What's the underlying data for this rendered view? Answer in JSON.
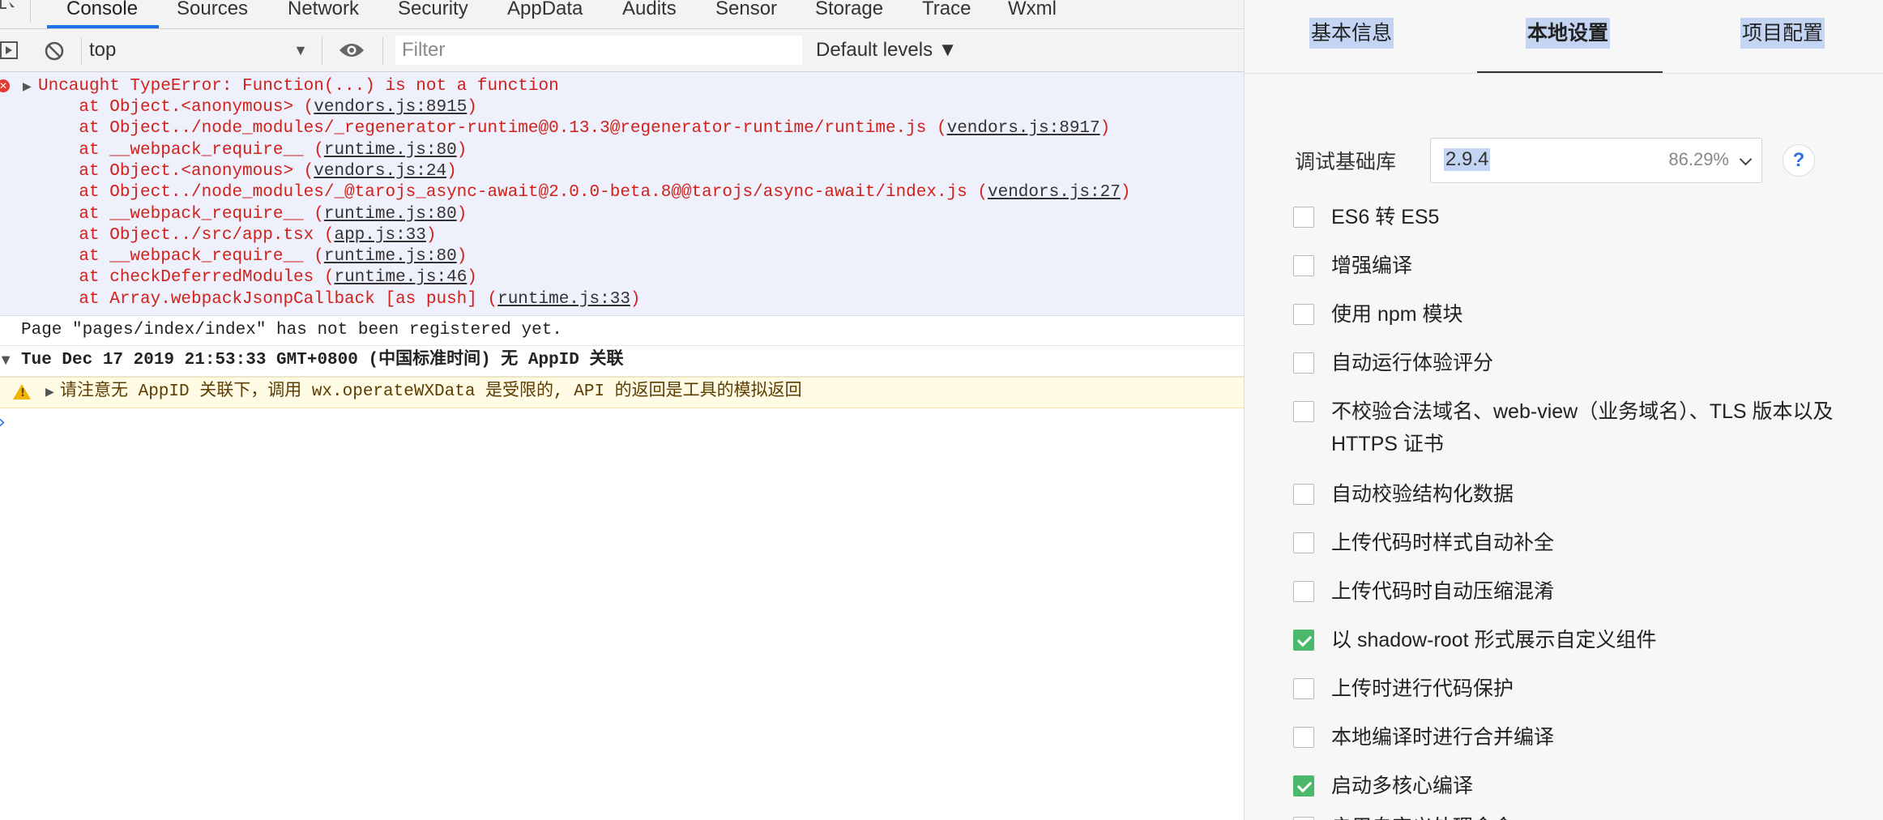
{
  "devtools": {
    "tabs": [
      "Console",
      "Sources",
      "Network",
      "Security",
      "AppData",
      "Audits",
      "Sensor",
      "Storage",
      "Trace",
      "Wxml"
    ],
    "active_tab": "Console",
    "toolbar": {
      "context": "top",
      "filter_placeholder": "Filter",
      "levels": "Default levels ▼"
    },
    "error": {
      "title": "Uncaught TypeError: Function(...) is not a function",
      "stack": [
        {
          "text": "    at Object.<anonymous> (",
          "link": "vendors.js:8915",
          "close": ")"
        },
        {
          "text": "    at Object../node_modules/_regenerator-runtime@0.13.3@regenerator-runtime/runtime.js (",
          "link": "vendors.js:8917",
          "close": ")"
        },
        {
          "text": "    at __webpack_require__ (",
          "link": "runtime.js:80",
          "close": ")"
        },
        {
          "text": "    at Object.<anonymous> (",
          "link": "vendors.js:24",
          "close": ")"
        },
        {
          "text": "    at Object../node_modules/_@tarojs_async-await@2.0.0-beta.8@@tarojs/async-await/index.js (",
          "link": "vendors.js:27",
          "close": ")"
        },
        {
          "text": "    at __webpack_require__ (",
          "link": "runtime.js:80",
          "close": ")"
        },
        {
          "text": "    at Object../src/app.tsx (",
          "link": "app.js:33",
          "close": ")"
        },
        {
          "text": "    at __webpack_require__ (",
          "link": "runtime.js:80",
          "close": ")"
        },
        {
          "text": "    at checkDeferredModules (",
          "link": "runtime.js:46",
          "close": ")"
        },
        {
          "text": "    at Array.webpackJsonpCallback [as push] (",
          "link": "runtime.js:33",
          "close": ")"
        }
      ]
    },
    "page_message": "Page \"pages/index/index\" has not been registered yet.",
    "group_header": "Tue Dec 17 2019 21:53:33 GMT+0800 (中国标准时间) 无 AppID 关联",
    "warning": "请注意无 AppID 关联下，调用 wx.operateWXData 是受限的, API 的返回是工具的模拟返回"
  },
  "settings": {
    "tabs": [
      "基本信息",
      "本地设置",
      "项目配置"
    ],
    "active_tab": "本地设置",
    "base_lib": {
      "label": "调试基础库",
      "version": "2.9.4",
      "percent": "86.29%",
      "help": "?"
    },
    "options": [
      {
        "label": "ES6 转 ES5",
        "checked": false
      },
      {
        "label": "增强编译",
        "checked": false
      },
      {
        "label": "使用 npm 模块",
        "checked": false
      },
      {
        "label": "自动运行体验评分",
        "checked": false
      },
      {
        "label": "不校验合法域名、web-view（业务域名）、TLS 版本以及 HTTPS 证书",
        "checked": false
      },
      {
        "label": "自动校验结构化数据",
        "checked": false
      },
      {
        "label": "上传代码时样式自动补全",
        "checked": false
      },
      {
        "label": "上传代码时自动压缩混淆",
        "checked": false
      },
      {
        "label": "以 shadow-root 形式展示自定义组件",
        "checked": true
      },
      {
        "label": "上传时进行代码保护",
        "checked": false
      },
      {
        "label": "本地编译时进行合并编译",
        "checked": false
      },
      {
        "label": "启动多核心编译",
        "checked": true
      },
      {
        "label": "启用自定义处理命令",
        "checked": false
      }
    ]
  },
  "colors": {
    "accent": "#1a73e8",
    "error_text": "#d0211b",
    "error_bg": "#eef0fb",
    "warning_bg": "#fffbe5",
    "checkbox_checked": "#4bb86c",
    "selection": "#c4d5f3"
  }
}
